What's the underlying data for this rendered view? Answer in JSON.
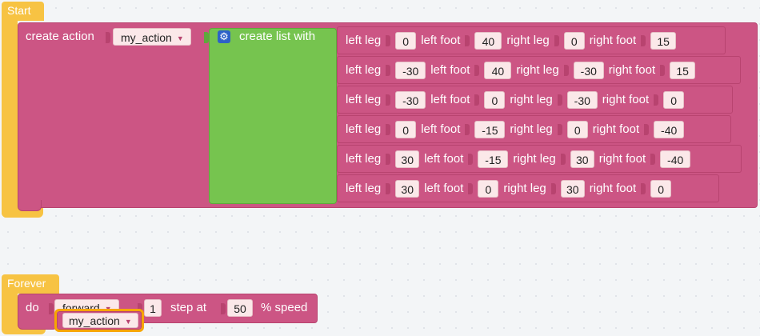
{
  "start": {
    "hat_label": "Start",
    "create_action_label": "create action",
    "action_name": "my_action",
    "create_list_label": "create list with",
    "labels": {
      "left_leg": "left leg",
      "left_foot": "left foot",
      "right_leg": "right leg",
      "right_foot": "right foot"
    },
    "rows": [
      {
        "left_leg": "0",
        "left_foot": "40",
        "right_leg": "0",
        "right_foot": "15"
      },
      {
        "left_leg": "-30",
        "left_foot": "40",
        "right_leg": "-30",
        "right_foot": "15"
      },
      {
        "left_leg": "-30",
        "left_foot": "0",
        "right_leg": "-30",
        "right_foot": "0"
      },
      {
        "left_leg": "0",
        "left_foot": "-15",
        "right_leg": "0",
        "right_foot": "-40"
      },
      {
        "left_leg": "30",
        "left_foot": "-15",
        "right_leg": "30",
        "right_foot": "-40"
      },
      {
        "left_leg": "30",
        "left_foot": "0",
        "right_leg": "30",
        "right_foot": "0"
      }
    ]
  },
  "forever": {
    "hat_label": "Forever",
    "do_label": "do",
    "direction": "forward",
    "steps": "1",
    "step_at_label": "step at",
    "speed": "50",
    "speed_label": "% speed",
    "action_name": "my_action"
  },
  "colors": {
    "hat": "#f7c343",
    "block_pink": "#cc5584",
    "list_green": "#76c44f",
    "field_bg": "#fbe8e9",
    "gear_blue": "#2d62c8"
  }
}
